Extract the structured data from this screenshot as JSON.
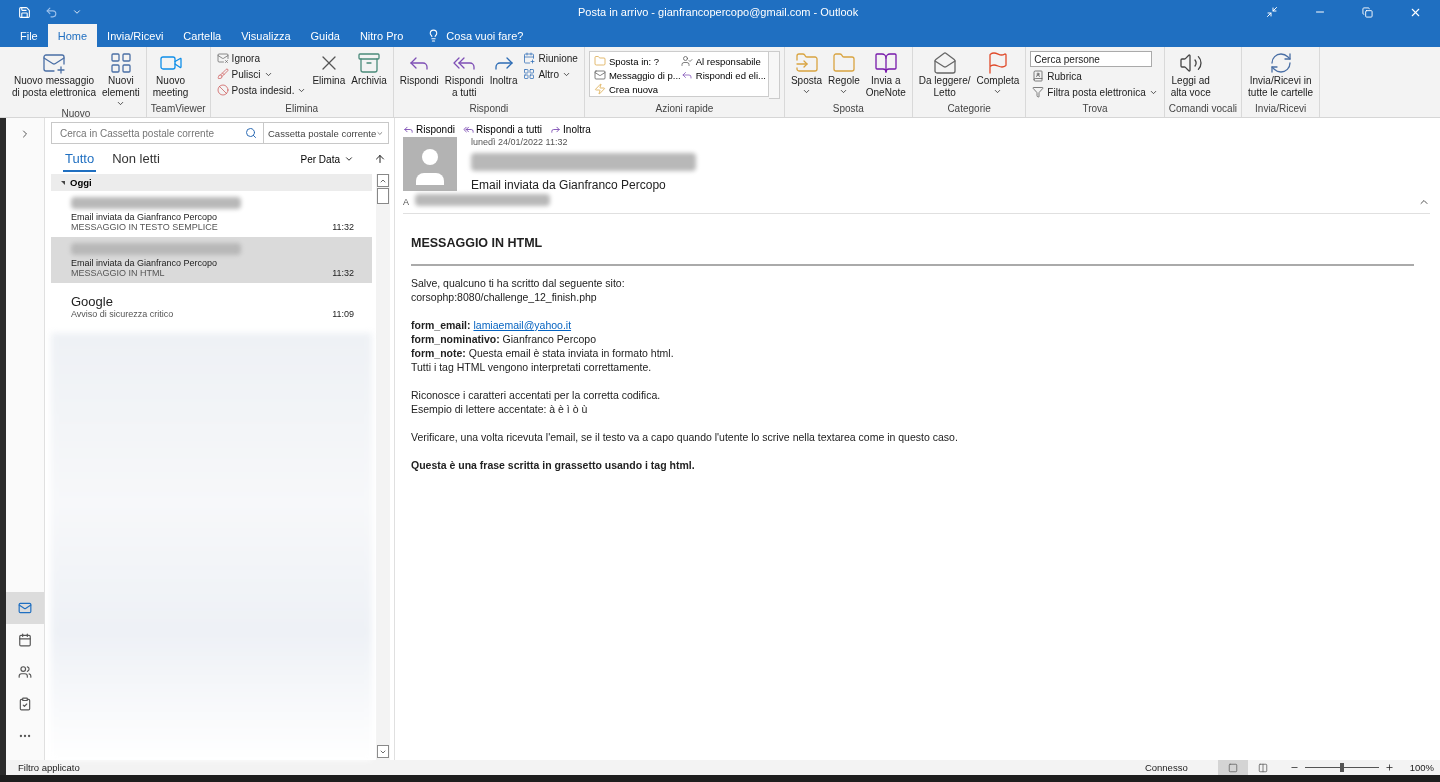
{
  "window": {
    "title": "Posta in arrivo - gianfrancopercopo@gmail.com  -  Outlook"
  },
  "tabs": [
    {
      "label": "File",
      "selected": false
    },
    {
      "label": "Home",
      "selected": true
    },
    {
      "label": "Invia/Ricevi",
      "selected": false
    },
    {
      "label": "Cartella",
      "selected": false
    },
    {
      "label": "Visualizza",
      "selected": false
    },
    {
      "label": "Guida",
      "selected": false
    },
    {
      "label": "Nitro Pro",
      "selected": false
    }
  ],
  "tell_me": "Cosa vuoi fare?",
  "ribbon": [
    {
      "label": "Nuovo",
      "items": [
        {
          "kind": "large",
          "label": "Nuovo messaggio\ndi posta elettronica",
          "dropdown": false
        },
        {
          "kind": "large",
          "label": "Nuovi\nelementi",
          "dropdown": true
        }
      ]
    },
    {
      "label": "TeamViewer",
      "items": [
        {
          "kind": "large",
          "label": "Nuovo\nmeeting",
          "dropdown": false
        }
      ]
    },
    {
      "label": "Elimina",
      "items": [
        {
          "kind": "column",
          "children": [
            {
              "label": "Ignora",
              "dropdown": false
            },
            {
              "label": "Pulisci",
              "dropdown": true
            },
            {
              "label": "Posta indesid.",
              "dropdown": true
            }
          ]
        },
        {
          "kind": "large",
          "label": "Elimina",
          "dropdown": false
        },
        {
          "kind": "large",
          "label": "Archivia",
          "dropdown": false
        }
      ]
    },
    {
      "label": "Rispondi",
      "items": [
        {
          "kind": "large",
          "label": "Rispondi",
          "dropdown": false
        },
        {
          "kind": "large",
          "label": "Rispondi\na tutti",
          "dropdown": false
        },
        {
          "kind": "large",
          "label": "Inoltra",
          "dropdown": false
        },
        {
          "kind": "column",
          "children": [
            {
              "label": "Riunione",
              "dropdown": false
            },
            {
              "label": "Altro",
              "dropdown": true
            }
          ]
        }
      ]
    },
    {
      "label": "Azioni rapide",
      "items": [
        {
          "kind": "gallery",
          "children": [
            {
              "label": "Sposta in: ?"
            },
            {
              "label": "Al responsabile"
            },
            {
              "label": "Messaggio di p..."
            },
            {
              "label": "Rispondi ed eli..."
            },
            {
              "label": "Crea nuova"
            }
          ]
        }
      ]
    },
    {
      "label": "Sposta",
      "items": [
        {
          "kind": "large",
          "label": "Sposta",
          "dropdown": true
        },
        {
          "kind": "large",
          "label": "Regole",
          "dropdown": true
        },
        {
          "kind": "large",
          "label": "Invia a\nOneNote",
          "dropdown": false
        }
      ]
    },
    {
      "label": "Categorie",
      "items": [
        {
          "kind": "large",
          "label": "Da leggere/\nLetto",
          "dropdown": false
        },
        {
          "kind": "large",
          "label": "Completa",
          "dropdown": true
        }
      ]
    },
    {
      "label": "Trova",
      "items": [
        {
          "kind": "column",
          "children": [
            {
              "kind": "search",
              "placeholder": "Cerca persone"
            },
            {
              "label": "Rubrica",
              "dropdown": false
            },
            {
              "label": "Filtra posta elettronica",
              "dropdown": true
            }
          ]
        }
      ]
    },
    {
      "label": "Comandi vocali",
      "items": [
        {
          "kind": "large",
          "label": "Leggi ad\nalta voce",
          "dropdown": false
        }
      ]
    },
    {
      "label": "Invia/Ricevi",
      "items": [
        {
          "kind": "large",
          "label": "Invia/Ricevi in\ntutte le cartelle",
          "dropdown": false
        }
      ]
    }
  ],
  "nav": [
    {
      "selected": true
    },
    {
      "selected": false
    },
    {
      "selected": false
    },
    {
      "selected": false
    }
  ],
  "mail_list": {
    "search_placeholder": "Cerca in Cassetta postale corrente",
    "scope": "Cassetta postale corrente",
    "filters": [
      {
        "label": "Tutto",
        "selected": true
      },
      {
        "label": "Non letti",
        "selected": false
      }
    ],
    "sort": "Per Data",
    "group": {
      "label": "Oggi",
      "expanded": true
    },
    "messages": [
      {
        "subject": "Email inviata da Gianfranco Percopo",
        "preview": "MESSAGGIO IN TESTO SEMPLICE",
        "time": "11:32",
        "selected": false
      },
      {
        "subject": "Email inviata da Gianfranco Percopo",
        "preview": "MESSAGGIO IN HTML",
        "time": "11:32",
        "selected": true
      },
      {
        "sender": "Google",
        "preview": "Avviso di sicurezza critico",
        "time": "11:09",
        "selected": false
      }
    ]
  },
  "reading": {
    "actions": [
      "Rispondi",
      "Rispondi a tutti",
      "Inoltra"
    ],
    "date": "lunedì 24/01/2022 11:32",
    "subject": "Email inviata da Gianfranco Percopo",
    "to_label": "A",
    "heading": "MESSAGGIO IN HTML",
    "paragraphs": [
      {
        "bold": false,
        "lines": [
          {
            "text": "Salve, qualcuno ti ha scritto dal seguente sito:"
          },
          {
            "text": "corsophp:8080/challenge_12_finish.php"
          }
        ]
      },
      {
        "bold": false,
        "lines": [
          {
            "text": "**form_email:** ",
            "link": "lamiaemail@yahoo.it"
          },
          {
            "text": "**form_nominativo:** Gianfranco Percopo"
          },
          {
            "text": "**form_note:** Questa email è stata inviata in formato html."
          },
          {
            "text": "Tutti i tag HTML vengono interpretati correttamente."
          }
        ]
      },
      {
        "bold": false,
        "lines": [
          {
            "text": "Riconosce i caratteri accentati per la corretta codifica."
          },
          {
            "text": "Esempio di lettere accentate: à è ì ò ù"
          }
        ]
      },
      {
        "bold": false,
        "lines": [
          {
            "text": "Verificare, una volta ricevuta l'email, se il testo va a capo quando l'utente lo scrive nella textarea come in questo caso."
          }
        ]
      },
      {
        "bold": true,
        "lines": [
          {
            "text": "Questa è una frase scritta in grassetto usando i tag html."
          }
        ]
      }
    ]
  },
  "status_bar": {
    "left": "Filtro applicato",
    "connection": "Connesso",
    "views": [
      {
        "selected": true
      },
      {
        "selected": false
      }
    ],
    "zoom": {
      "level": 0.5
    },
    "zoom_text": "100%"
  }
}
